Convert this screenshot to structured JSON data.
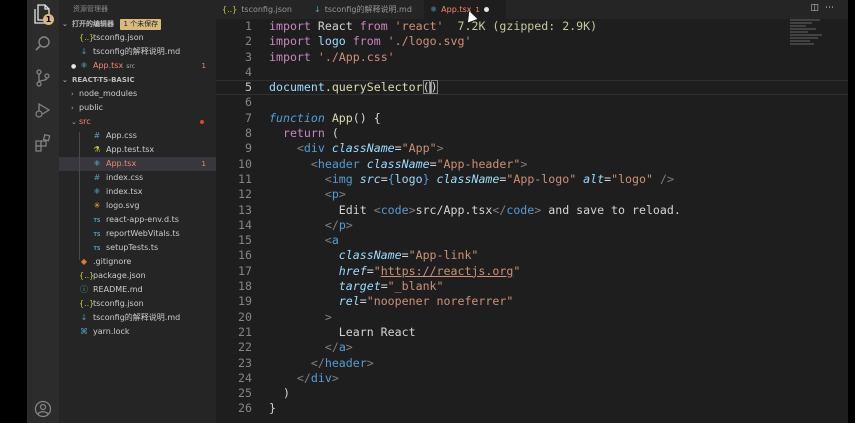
{
  "sidebar": {
    "title": "资源管理器",
    "open_editors": {
      "label": "打开的编辑器",
      "badge": "1 个未保存",
      "items": [
        {
          "icon": "{..}",
          "name": "tsconfig.json",
          "suffix": "",
          "count": "",
          "state": "normal"
        },
        {
          "icon": "↓",
          "name": "tsconfig的解释说明.md",
          "suffix": "",
          "count": "",
          "state": "normal"
        },
        {
          "icon": "⚛",
          "name": "App.tsx",
          "suffix": "src",
          "count": "1",
          "state": "modified"
        }
      ]
    },
    "project": {
      "label": "REACT-TS-BASIC",
      "items": [
        {
          "type": "folder",
          "name": "node_modules",
          "level": 0,
          "open": false
        },
        {
          "type": "folder",
          "name": "public",
          "level": 0,
          "open": false
        },
        {
          "type": "folder",
          "name": "src",
          "level": 0,
          "open": true,
          "state": "error"
        },
        {
          "type": "file",
          "icon": "#",
          "name": "App.css",
          "level": 1
        },
        {
          "type": "file",
          "icon": "⚗",
          "name": "App.test.tsx",
          "level": 1
        },
        {
          "type": "file",
          "icon": "⚛",
          "name": "App.tsx",
          "level": 1,
          "count": "1",
          "state": "error",
          "selected": true
        },
        {
          "type": "file",
          "icon": "#",
          "name": "index.css",
          "level": 1
        },
        {
          "type": "file",
          "icon": "⚛",
          "name": "index.tsx",
          "level": 1
        },
        {
          "type": "file",
          "icon": "✳",
          "name": "logo.svg",
          "level": 1
        },
        {
          "type": "file",
          "icon": "TS",
          "name": "react-app-env.d.ts",
          "level": 1
        },
        {
          "type": "file",
          "icon": "TS",
          "name": "reportWebVitals.ts",
          "level": 1
        },
        {
          "type": "file",
          "icon": "TS",
          "name": "setupTests.ts",
          "level": 1
        },
        {
          "type": "file",
          "icon": "◆",
          "name": ".gitignore",
          "level": 0
        },
        {
          "type": "file",
          "icon": "{..}",
          "name": "package.json",
          "level": 0
        },
        {
          "type": "file",
          "icon": "ⓘ",
          "name": "README.md",
          "level": 0
        },
        {
          "type": "file",
          "icon": "{..}",
          "name": "tsconfig.json",
          "level": 0
        },
        {
          "type": "file",
          "icon": "↓",
          "name": "tsconfig的解释说明.md",
          "level": 0
        },
        {
          "type": "file",
          "icon": "⌘",
          "name": "yarn.lock",
          "level": 0
        }
      ]
    }
  },
  "tabs": [
    {
      "icon": "{..}",
      "label": "tsconfig.json"
    },
    {
      "icon": "↓",
      "label": "tsconfig的解释说明.md"
    },
    {
      "icon": "⚛",
      "label": "App.tsx",
      "count": "1",
      "active": true
    }
  ],
  "code": {
    "line_numbers": [
      "1",
      "2",
      "3",
      "4",
      "5",
      "6",
      "7",
      "8",
      "9",
      "10",
      "11",
      "12",
      "13",
      "14",
      "15",
      "16",
      "17",
      "18",
      "19",
      "20",
      "21",
      "22",
      "23",
      "24",
      "25",
      "26"
    ],
    "current_line": "5",
    "import_hint": "7.2K (gzipped: 2.9K)"
  },
  "colors": {
    "keyword": "#c586c0",
    "string": "#ce9178",
    "function": "#dcdcaa",
    "tag": "#569cd6",
    "attribute": "#9cdcfe",
    "error": "#f48771",
    "modified": "#e2c08d"
  }
}
